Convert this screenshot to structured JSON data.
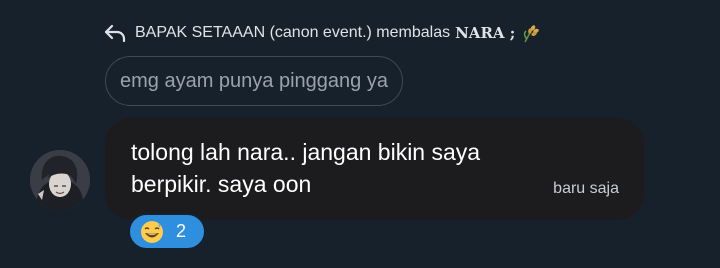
{
  "reply": {
    "prefix": "BAPAK SETAAAN (canon event.) membalas",
    "name": "NARA ;",
    "icon": "rice-plant-icon"
  },
  "quoted_message": {
    "text": "emg ayam punya pinggang ya"
  },
  "message": {
    "text": "tolong lah nara.. jangan bikin saya berpikir. saya oon",
    "time": "baru saja",
    "avatar": "avatar-dark-hair"
  },
  "reaction": {
    "emoji": "grinning-sweat-emoji-icon",
    "count": "2",
    "color": "#2e8fde"
  },
  "colors": {
    "background": "#17212b",
    "bubble": "#1c1c1e",
    "quote_border": "#3e4a56",
    "accent": "#2e8fde"
  }
}
